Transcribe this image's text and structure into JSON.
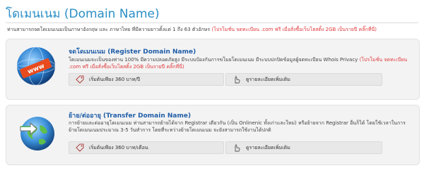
{
  "page": {
    "title": "โดเมนเนม (Domain Name)",
    "intro_text": "ท่านสามารถจดโดเมนเนมเป็นภาษาอังกฤษ และ ภาษาไทย ที่มีความยาวตั้งแต่ 1 ถึง 63 ตัวอักษร",
    "intro_promo": "(โปรโมชั่น จดทะเบียน .com ฟรี เมื่อสั่งซื้อเว็บโฮสติ้ง 2GB เป็นรายปี คลิ๊กที่นี่)"
  },
  "register": {
    "heading": "จดโดเมนเนม (Register Domain Name)",
    "desc": "โดเมนเนมจะเป็นของท่าน 100% มีความปลอดภัยสูง มีระบบป้องกันการขโมยโดเมนเนม มีระบบปกปิดข้อมูลผู้จดทะเบียน Whois Privacy",
    "promo": "(โปรโมชั่น จดทะเบียน .com ฟรี เมื่อสั่งซื้อเว็บโฮสติ้ง 2GB เป็นรายปี คลิ๊กที่นี่)",
    "price_label": "เริ่มต้นเพียง 360 บาท/ปี",
    "detail_label": "ดูรายละเอียดเพิ่มเติม",
    "icon_text": "www"
  },
  "transfer": {
    "heading": "ย้าย/ต่ออายุ (Transfer Domain Name)",
    "desc": "การย้ายและต่ออายุโดเมนเนม ท่านสามารถย้ายได้จาก Registrar เดียวกัน (เป็น Onlinenic ทั้งเก่าและใหม่) หรือย้ายจาก Registrar อื่นก็ได้ โดยใช้เวลาในการย้ายโดเมนเนมประมาณ 3-5 วันทำการ โดยที่ระหว่างย้ายโดเมนเนม จะยังสามารถใช้งานได้ปกติ",
    "price_label": "เริ่มต้นเพียง 360 บาท/เดือน",
    "detail_label": "ดูรายละเอียดเพิ่มเติม"
  },
  "colors": {
    "title": "#2a8fc6",
    "heading": "#1f5da8",
    "promo": "#e0383b"
  }
}
